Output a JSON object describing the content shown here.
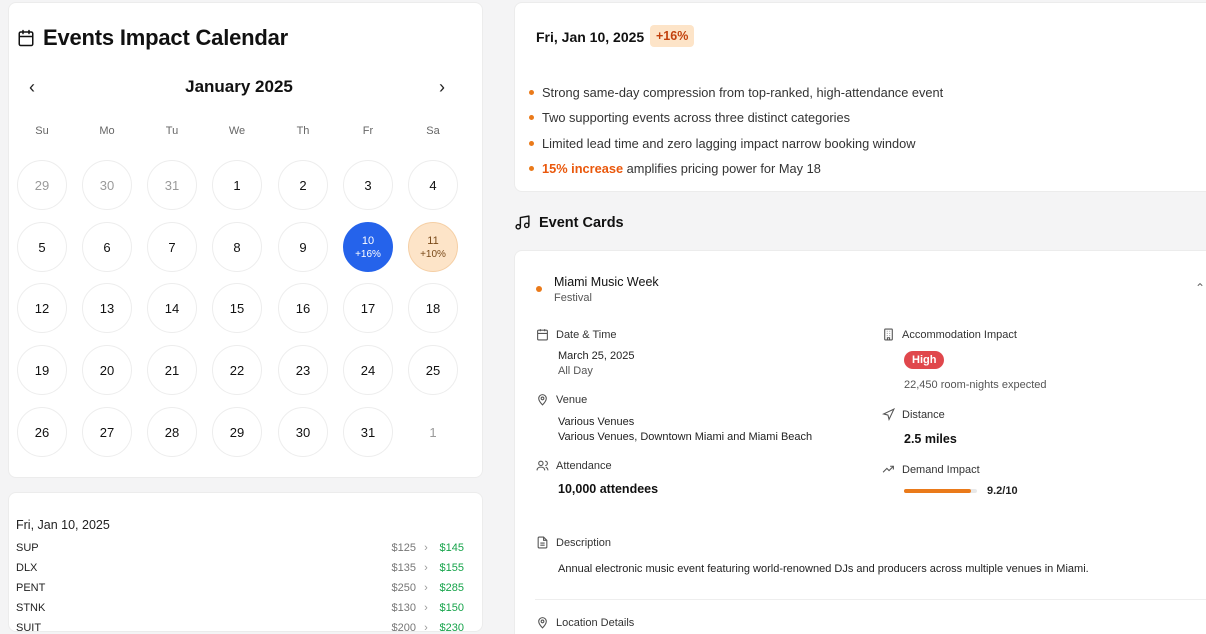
{
  "calendar": {
    "title": "Events Impact Calendar",
    "month": "January 2025",
    "prev": "‹",
    "next": "›",
    "weekdays": [
      "Su",
      "Mo",
      "Tu",
      "We",
      "Th",
      "Fr",
      "Sa"
    ],
    "days": [
      {
        "label": "29",
        "muted": true
      },
      {
        "label": "30",
        "muted": true
      },
      {
        "label": "31",
        "muted": true
      },
      {
        "label": "1"
      },
      {
        "label": "2"
      },
      {
        "label": "3"
      },
      {
        "label": "4"
      },
      {
        "label": "5"
      },
      {
        "label": "6"
      },
      {
        "label": "7"
      },
      {
        "label": "8"
      },
      {
        "label": "9"
      },
      {
        "label": "10",
        "pct": "+16%",
        "state": "selected"
      },
      {
        "label": "11",
        "pct": "+10%",
        "state": "peach"
      },
      {
        "label": "12"
      },
      {
        "label": "13"
      },
      {
        "label": "14"
      },
      {
        "label": "15"
      },
      {
        "label": "16"
      },
      {
        "label": "17"
      },
      {
        "label": "18"
      },
      {
        "label": "19"
      },
      {
        "label": "20"
      },
      {
        "label": "21"
      },
      {
        "label": "22"
      },
      {
        "label": "23"
      },
      {
        "label": "24"
      },
      {
        "label": "25"
      },
      {
        "label": "26"
      },
      {
        "label": "27"
      },
      {
        "label": "28"
      },
      {
        "label": "29"
      },
      {
        "label": "30"
      },
      {
        "label": "31"
      },
      {
        "label": "1",
        "muted": true,
        "noborder": true
      }
    ]
  },
  "rates": {
    "date": "Fri, Jan 10, 2025",
    "rows": [
      {
        "name": "SUP",
        "old": "$125",
        "new": "$145"
      },
      {
        "name": "DLX",
        "old": "$135",
        "new": "$155"
      },
      {
        "name": "PENT",
        "old": "$250",
        "new": "$285"
      },
      {
        "name": "STNK",
        "old": "$130",
        "new": "$150"
      },
      {
        "name": "SUIT",
        "old": "$200",
        "new": "$230"
      }
    ]
  },
  "summary": {
    "date": "Fri, Jan 10, 2025",
    "badge": "+16%",
    "bullets": [
      "Strong same-day compression from top-ranked, high-attendance event",
      "Two supporting events across three distinct categories",
      "Limited lead time and zero lagging impact narrow booking window"
    ],
    "last_bullet_highlight": "15% increase",
    "last_bullet_rest": " amplifies pricing power for May 18"
  },
  "events": {
    "header": "Event Cards",
    "card": {
      "name": "Miami Music Week",
      "category": "Festival",
      "datetime_label": "Date & Time",
      "date": "March 25, 2025",
      "time": "All Day",
      "venue_label": "Venue",
      "venue": "Various Venues",
      "venue_detail": "Various Venues, Downtown Miami and Miami Beach",
      "attendance_label": "Attendance",
      "attendance": "10,000 attendees",
      "accommodation_label": "Accommodation Impact",
      "accommodation_level": "High",
      "room_nights": "22,450 room-nights expected",
      "distance_label": "Distance",
      "distance": "2.5 miles",
      "demand_label": "Demand Impact",
      "demand_score": "9.2/10",
      "demand_fraction": 0.92,
      "description_label": "Description",
      "description": "Annual electronic music event featuring world-renowned DJs and producers across multiple venues in Miami.",
      "location_label": "Location Details"
    }
  },
  "colors": {
    "accent": "#2563eb",
    "orange": "#ea7a1a",
    "high": "#e0474c",
    "green": "#16a34a"
  }
}
